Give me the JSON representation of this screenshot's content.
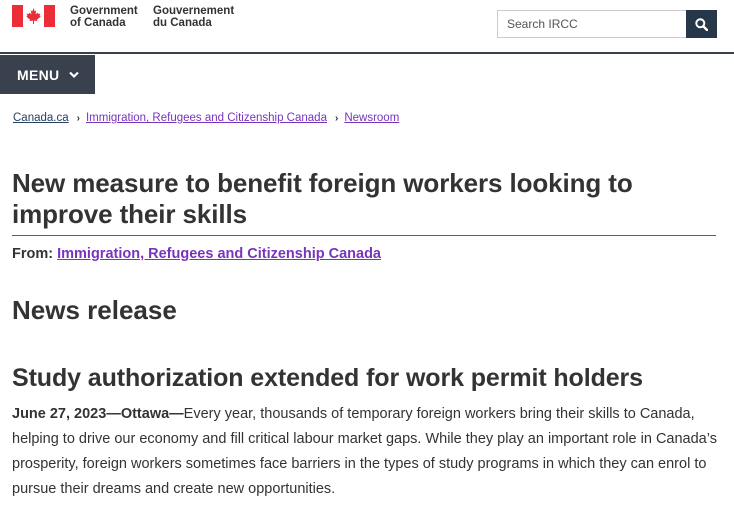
{
  "header": {
    "signature_en": "Government\nof Canada",
    "signature_fr": "Gouvernement\ndu Canada",
    "flag_colors": {
      "red": "#eb2d37",
      "white": "#ffffff"
    },
    "search": {
      "placeholder": "Search IRCC",
      "icon": "search-icon",
      "button_color": "#26374a"
    }
  },
  "menu": {
    "label": "MENU",
    "icon": "chevron-down-icon",
    "background": "#38414d"
  },
  "breadcrumb": [
    {
      "label": "Canada.ca"
    },
    {
      "label": "Immigration, Refugees and Citizenship Canada"
    },
    {
      "label": "Newsroom"
    }
  ],
  "page": {
    "title": "New measure to benefit foreign workers looking to improve their skills",
    "from_label": "From: ",
    "from_link": "Immigration, Refugees and Citizenship Canada",
    "section_label": "News release",
    "subtitle": "Study authorization extended for work permit holders",
    "dateline": "June 27, 2023—Ottawa—",
    "body": "Every year, thousands of temporary foreign workers bring their skills to Canada, helping to drive our economy and fill critical labour market gaps. While they play an important role in Canada’s prosperity, foreign workers sometimes face barriers in the types of study programs in which they can enrol to pursue their dreams and create new opportunities."
  },
  "colors": {
    "title_rule": "#af3c43",
    "link": "#284162",
    "visited_link": "#7834bc"
  }
}
